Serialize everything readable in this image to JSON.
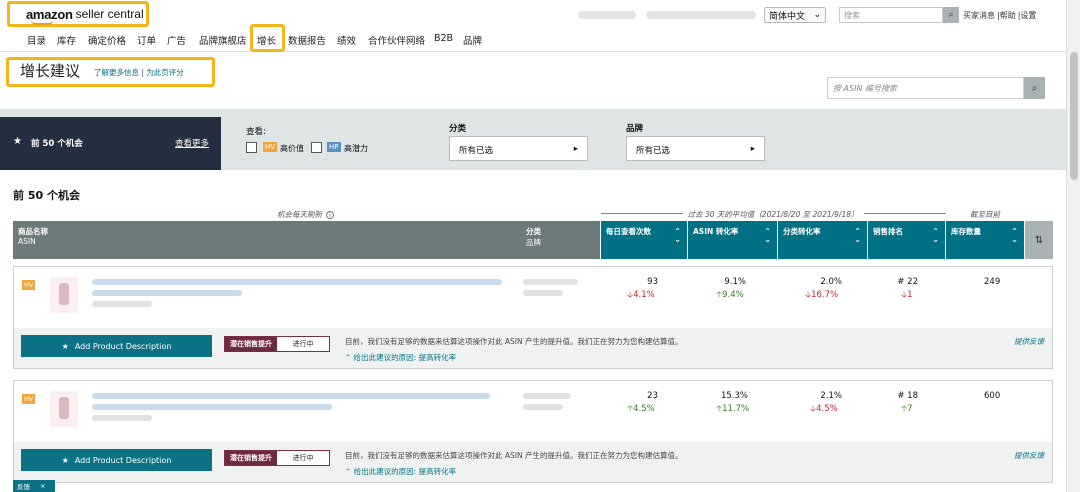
{
  "header": {
    "logo_brand": "amazon",
    "logo_product": "seller central",
    "language": "简体中文",
    "search_placeholder": "搜索",
    "links": [
      "买家消息",
      "帮助",
      "设置"
    ]
  },
  "nav": {
    "items": [
      "目录",
      "库存",
      "确定价格",
      "订单",
      "广告",
      "品牌旗舰店",
      "增长",
      "数据报告",
      "绩效",
      "合作伙伴网络",
      "B2B",
      "品牌"
    ],
    "active": "增长"
  },
  "page": {
    "title": "增长建议",
    "link_learn": "了解更多信息",
    "link_rate": "为此页评分",
    "asin_search_placeholder": "按 ASIN 编号搜索"
  },
  "filters": {
    "top50_label": "前 50 个机会",
    "see_more": "查看更多",
    "view_label": "查看:",
    "hv_tag": "HV",
    "hv_text": "高价值",
    "hp_tag": "HP",
    "hp_text": "高潜力",
    "category_label": "分类",
    "category_value": "所有已选",
    "brand_label": "品牌",
    "brand_value": "所有已选"
  },
  "section": {
    "title": "前 50 个机会",
    "refresh_note": "机会每天刷新",
    "avg_note": "过去 30 天的平均值（2021/8/20 至 2021/9/18）",
    "current_note": "截至目前"
  },
  "table": {
    "col_product": "商品名称",
    "col_product_sub": "ASIN",
    "col_category": "分类",
    "col_category_sub": "品牌",
    "col_daily_views": "每日查看次数",
    "col_asin_conv": "ASIN 转化率",
    "col_cat_conv": "分类转化率",
    "col_rank": "销售排名",
    "col_stock": "库存数量"
  },
  "rows": [
    {
      "badge": "HV",
      "daily_views": "93",
      "daily_views_chg": "4.1%",
      "asin_conv": "9.1%",
      "asin_conv_chg": "9.4%",
      "cat_conv": "2.0%",
      "cat_conv_chg": "16.7%",
      "rank": "# 22",
      "rank_chg": "1",
      "stock": "249",
      "action": "Add Product Description",
      "status_a": "潜在销售提升",
      "status_b": "进行中",
      "note": "目前，我们没有足够的数据来估算这项操作对此 ASIN 产生的提升值。我们正在努力为您构建估算值。",
      "reason_label": "给出此建议的原因:",
      "reason_value": "提高转化率",
      "feedback": "提供反馈"
    },
    {
      "badge": "HV",
      "daily_views": "23",
      "daily_views_chg": "4.5%",
      "asin_conv": "15.3%",
      "asin_conv_chg": "11.7%",
      "cat_conv": "2.1%",
      "cat_conv_chg": "4.5%",
      "rank": "# 18",
      "rank_chg": "7",
      "stock": "600",
      "action": "Add Product Description",
      "status_a": "潜在销售提升",
      "status_b": "进行中",
      "note": "目前，我们没有足够的数据来估算这项操作对此 ASIN 产生的提升值。我们正在努力为您构建估算值。",
      "reason_label": "给出此建议的原因:",
      "reason_value": "提高转化率",
      "feedback": "提供反馈"
    }
  ],
  "footer": {
    "feedback_tab": "反馈",
    "close": "×"
  },
  "colors": {
    "highlight": "#f6b41a",
    "primary": "#007185",
    "dark": "#232f3e",
    "down": "#c0232c",
    "up": "#3b7a24"
  }
}
